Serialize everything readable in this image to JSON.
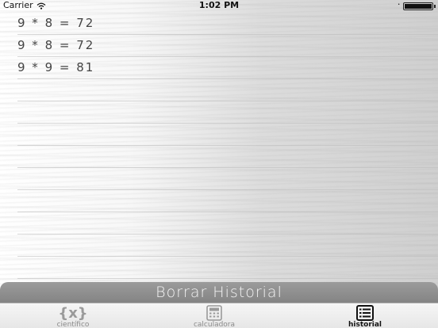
{
  "status_bar": {
    "carrier": "Carrier",
    "time": "1:02 PM"
  },
  "history": {
    "entries": [
      "9 * 8 = 72",
      "9 * 8 = 72",
      "9 * 9 = 81"
    ]
  },
  "clear_button_label": "Borrar Historial",
  "tabs": [
    {
      "label": "científico",
      "icon": "braces-x-icon",
      "active": false
    },
    {
      "label": "calculadora",
      "icon": "calculator-icon",
      "active": false
    },
    {
      "label": "historial",
      "icon": "list-icon",
      "active": true
    }
  ],
  "colors": {
    "clear_button": "#8f8f8f",
    "tab_active": "#111111",
    "tab_inactive": "#8a8a8a"
  }
}
